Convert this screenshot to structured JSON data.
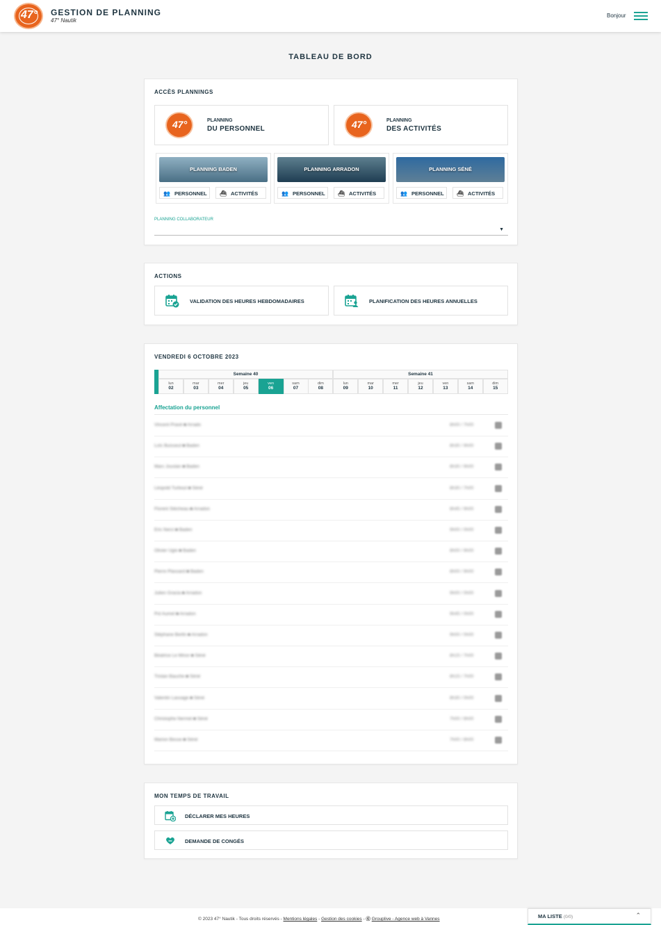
{
  "header": {
    "logo_text": "47°",
    "title": "GESTION DE PLANNING",
    "subtitle": "47° Nautik",
    "greeting": "Bonjour"
  },
  "page_title": "TABLEAU DE BORD",
  "plannings": {
    "title": "ACCÈS PLANNINGS",
    "personnel": {
      "line1": "PLANNING",
      "line2": "DU PERSONNEL"
    },
    "activites": {
      "line1": "PLANNING",
      "line2": "DES ACTIVITÉS"
    },
    "sites": [
      {
        "label": "PLANNING BADEN",
        "personnel": "PERSONNEL",
        "activites": "ACTIVITÉS",
        "colors": [
          "#4a6f85",
          "#8fb0c2"
        ]
      },
      {
        "label": "PLANNING ARRADON",
        "personnel": "PERSONNEL",
        "activites": "ACTIVITÉS",
        "colors": [
          "#1f3d52",
          "#5d7f8f"
        ]
      },
      {
        "label": "PLANNING SÉNÉ",
        "personnel": "PERSONNEL",
        "activites": "ACTIVITÉS",
        "colors": [
          "#5e7f96",
          "#2f6aa0"
        ]
      }
    ],
    "collab_label": "PLANNING COLLABORATEUR",
    "collab_value": ""
  },
  "actions": {
    "title": "ACTIONS",
    "validation": "VALIDATION DES HEURES HEBDOMADAIRES",
    "planification": "PLANIFICATION DES HEURES ANNUELLES"
  },
  "calendar": {
    "title": "VENDREDI 6 OCTOBRE 2023",
    "weeks": [
      "Semaine 40",
      "Semaine 41"
    ],
    "days": [
      {
        "dn": "lun",
        "dd": "02"
      },
      {
        "dn": "mar",
        "dd": "03"
      },
      {
        "dn": "mer",
        "dd": "04"
      },
      {
        "dn": "jeu",
        "dd": "05"
      },
      {
        "dn": "ven",
        "dd": "06"
      },
      {
        "dn": "sam",
        "dd": "07"
      },
      {
        "dn": "dim",
        "dd": "08"
      },
      {
        "dn": "lun",
        "dd": "09"
      },
      {
        "dn": "mar",
        "dd": "10"
      },
      {
        "dn": "mer",
        "dd": "11"
      },
      {
        "dn": "jeu",
        "dd": "12"
      },
      {
        "dn": "ven",
        "dd": "13"
      },
      {
        "dn": "sam",
        "dd": "14"
      },
      {
        "dn": "dim",
        "dd": "15"
      }
    ],
    "active_index": 4,
    "assign_title": "Affectation du personnel",
    "rows": [
      {
        "name": "Vincent Pravé ■ Arrado",
        "hours": "8h00 / 7h00"
      },
      {
        "name": "Loïc Buisseul ■ Baden",
        "hours": "8h30 / 9h00"
      },
      {
        "name": "Marc Jouslan ■ Baden",
        "hours": "8h30 / 9h00"
      },
      {
        "name": "Léopold Turbout ■ Séné",
        "hours": "8h30 / 7h00"
      },
      {
        "name": "Florent Stécheau ■ Arradon",
        "hours": "8h45 / 9h00"
      },
      {
        "name": "Eric Nerci ■ Baden",
        "hours": "9h00 / 0h00"
      },
      {
        "name": "Olivier Ugie ■ Baden",
        "hours": "8h00 / 9h00"
      },
      {
        "name": "Pierre Plassard ■ Baden",
        "hours": "8h00 / 9h00"
      },
      {
        "name": "Julien Gracia ■ Arradon",
        "hours": "9h00 / 0h00"
      },
      {
        "name": "Pol Aumel ■ Arradon",
        "hours": "9h45 / 0h00"
      },
      {
        "name": "Stéphane Berlin ■ Arradon",
        "hours": "9h00 / 0h00"
      },
      {
        "name": "Béatrice Le Minor ■ Séné",
        "hours": "8h15 / 7h00"
      },
      {
        "name": "Tristan Bauche ■ Séné",
        "hours": "8h15 / 7h00"
      },
      {
        "name": "Valentin Lassage ■ Séné",
        "hours": "8h30 / 0h00"
      },
      {
        "name": "Christophe Nermel ■ Séné",
        "hours": "7h00 / 8h00"
      },
      {
        "name": "Marion Besse ■ Séné",
        "hours": "7h00 / 8h00"
      }
    ]
  },
  "worktime": {
    "title": "MON TEMPS DE TRAVAIL",
    "declare": "DÉCLARER MES HEURES",
    "conges": "DEMANDE DE CONGÉS"
  },
  "footer": {
    "copyright": "© 2023 47° Nautik - Tous droits réservés - ",
    "mentions": "Mentions légales",
    "sep1": " - ",
    "cookies": "Gestion des cookies",
    "sep2": " - ",
    "grouplive": "Grouplive - Agence web à Vannes"
  },
  "mylist": {
    "label": "MA LISTE",
    "count": "(0/0)"
  },
  "colors": {
    "accent": "#1aa393",
    "brand": "#e8641e",
    "navy": "#1e3440"
  }
}
